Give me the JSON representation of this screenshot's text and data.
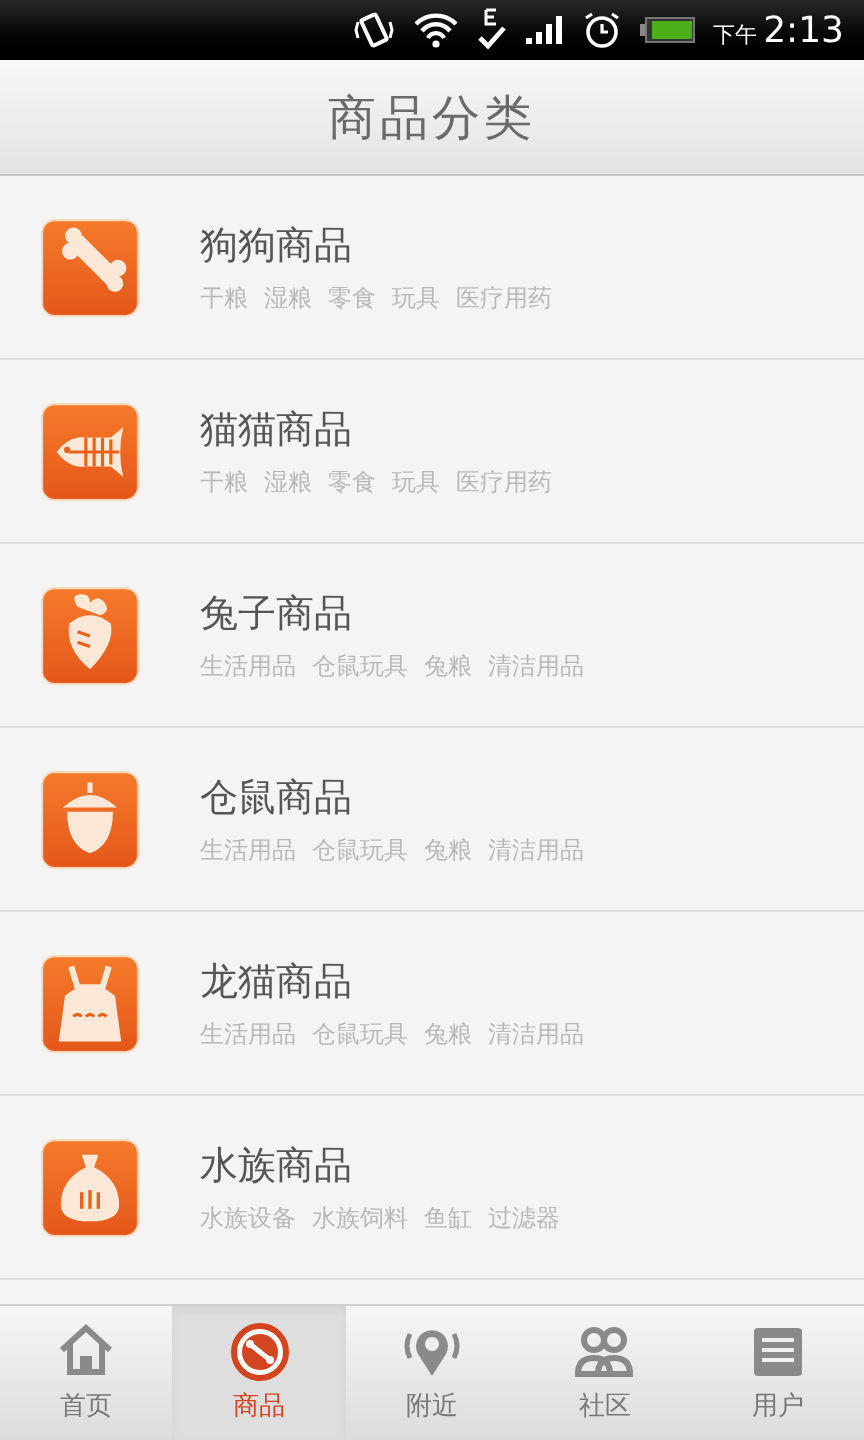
{
  "status_bar": {
    "time_period": "下午",
    "time": "2:13"
  },
  "header": {
    "title": "商品分类"
  },
  "categories": [
    {
      "name": "狗狗商品",
      "tags": [
        "干粮",
        "湿粮",
        "零食",
        "玩具",
        "医疗用药"
      ]
    },
    {
      "name": "猫猫商品",
      "tags": [
        "干粮",
        "湿粮",
        "零食",
        "玩具",
        "医疗用药"
      ]
    },
    {
      "name": "兔子商品",
      "tags": [
        "生活用品",
        "仓鼠玩具",
        "兔粮",
        "清洁用品"
      ]
    },
    {
      "name": "仓鼠商品",
      "tags": [
        "生活用品",
        "仓鼠玩具",
        "兔粮",
        "清洁用品"
      ]
    },
    {
      "name": "龙猫商品",
      "tags": [
        "生活用品",
        "仓鼠玩具",
        "兔粮",
        "清洁用品"
      ]
    },
    {
      "name": "水族商品",
      "tags": [
        "水族设备",
        "水族饲料",
        "鱼缸",
        "过滤器"
      ]
    }
  ],
  "tab_bar": [
    {
      "label": "首页",
      "selected": false
    },
    {
      "label": "商品",
      "selected": true
    },
    {
      "label": "附近",
      "selected": false
    },
    {
      "label": "社区",
      "selected": false
    },
    {
      "label": "用户",
      "selected": false
    }
  ]
}
